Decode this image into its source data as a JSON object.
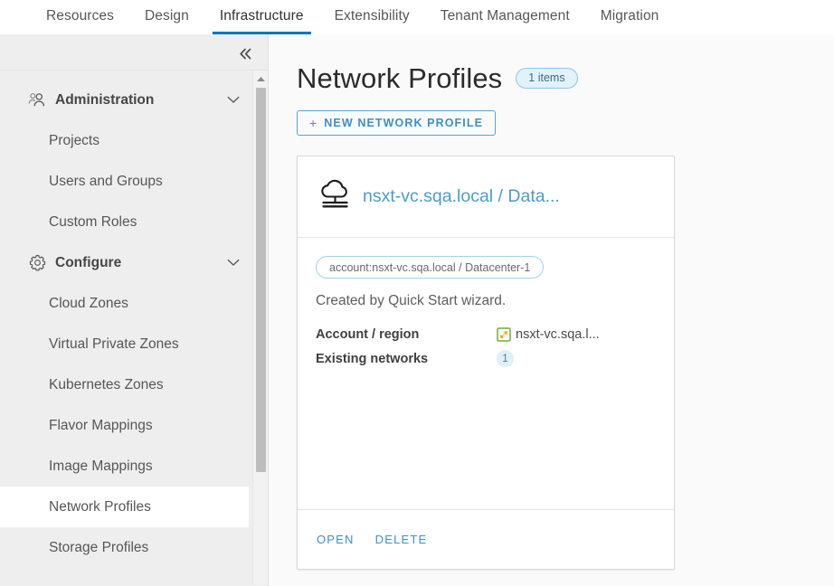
{
  "topnav": {
    "tabs": [
      {
        "label": "Resources",
        "active": false
      },
      {
        "label": "Design",
        "active": false
      },
      {
        "label": "Infrastructure",
        "active": true
      },
      {
        "label": "Extensibility",
        "active": false
      },
      {
        "label": "Tenant Management",
        "active": false
      },
      {
        "label": "Migration",
        "active": false
      }
    ]
  },
  "sidebar": {
    "collapse_icon": "double-chevron-left-icon",
    "scrollbar": {
      "up_arrow_icon": "caret-up-icon"
    },
    "groups": [
      {
        "label": "Administration",
        "icon": "users-group-icon",
        "caret": "chevron-down-icon",
        "items": [
          {
            "label": "Projects",
            "selected": false
          },
          {
            "label": "Users and Groups",
            "selected": false
          },
          {
            "label": "Custom Roles",
            "selected": false
          }
        ]
      },
      {
        "label": "Configure",
        "icon": "gear-icon",
        "caret": "chevron-down-icon",
        "items": [
          {
            "label": "Cloud Zones",
            "selected": false
          },
          {
            "label": "Virtual Private Zones",
            "selected": false
          },
          {
            "label": "Kubernetes Zones",
            "selected": false
          },
          {
            "label": "Flavor Mappings",
            "selected": false
          },
          {
            "label": "Image Mappings",
            "selected": false
          },
          {
            "label": "Network Profiles",
            "selected": true
          },
          {
            "label": "Storage Profiles",
            "selected": false
          }
        ]
      }
    ]
  },
  "main": {
    "title": "Network Profiles",
    "count_badge": "1 items",
    "new_button": {
      "plus": "+",
      "label": "NEW NETWORK PROFILE"
    },
    "card": {
      "header_icon": "cloud-network-icon",
      "title": "nsxt-vc.sqa.local / Data...",
      "chip": "account:nsxt-vc.sqa.local / Datacenter-1",
      "description": "Created by Quick Start wizard.",
      "fields": [
        {
          "key": "Account / region",
          "value": "nsxt-vc.sqa.l...",
          "icon": "vsphere-datacenter-icon",
          "badge": false
        },
        {
          "key": "Existing networks",
          "value": "1",
          "icon": null,
          "badge": true
        }
      ],
      "actions": [
        {
          "label": "OPEN"
        },
        {
          "label": "DELETE"
        }
      ]
    }
  },
  "colors": {
    "accent_blue": "#0076ba",
    "link_blue": "#3b92c6",
    "card_title_blue": "#4a9bd1",
    "badge_bg": "#e1f2fa",
    "sidebar_bg": "#eeeeee",
    "main_bg": "#fafafa"
  }
}
